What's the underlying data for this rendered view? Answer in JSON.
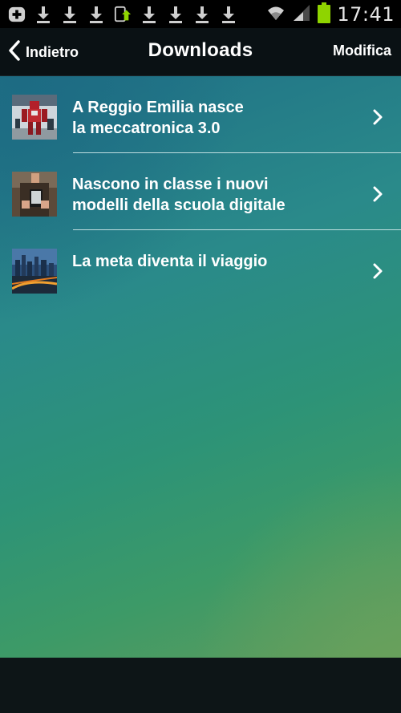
{
  "status_bar": {
    "time": "17:41",
    "notification_icons": [
      "add-box-icon",
      "download-icon",
      "download-icon",
      "download-icon",
      "screen-update-icon",
      "download-icon",
      "download-icon",
      "download-icon",
      "download-icon"
    ],
    "wifi_icon": "wifi-icon",
    "signal_icon": "signal-icon",
    "battery_icon": "battery-icon",
    "battery_color": "#8fd400"
  },
  "header": {
    "back_label": "Indietro",
    "title": "Downloads",
    "edit_label": "Modifica"
  },
  "downloads": [
    {
      "title": "A Reggio Emilia nasce\nla meccatronica 3.0",
      "thumb": "robot-thumbnail"
    },
    {
      "title": "Nascono in classe i nuovi\nmodelli della scuola digitale",
      "thumb": "tablet-thumbnail"
    },
    {
      "title": "La meta diventa il viaggio",
      "thumb": "city-thumbnail"
    }
  ],
  "colors": {
    "header_bg": "#0a1114",
    "content_top": "#1f6f86",
    "content_bottom": "#5e9c5d"
  }
}
